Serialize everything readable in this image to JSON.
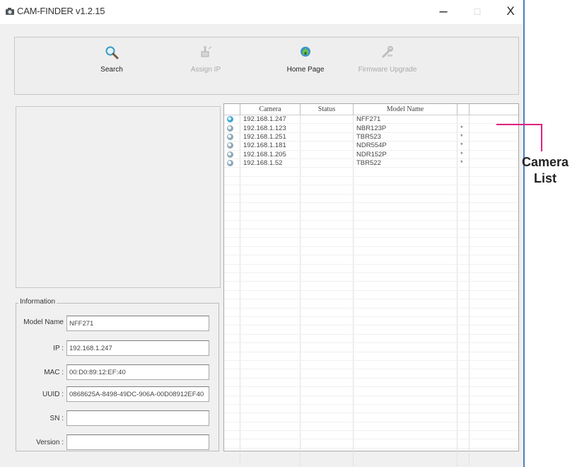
{
  "window": {
    "title": "CAM-FINDER v1.2.15",
    "minimize_glyph": "–",
    "maximize_glyph": "□",
    "close_glyph": "X"
  },
  "toolbar": {
    "search_label": "Search",
    "assign_ip_label": "Assign IP",
    "home_page_label": "Home Page",
    "firmware_upgrade_label": "Firmware Upgrade"
  },
  "camera_list": {
    "columns": [
      "Camera",
      "Status",
      "Model Name"
    ],
    "rows": [
      {
        "camera": "192.168.1.247",
        "status": "",
        "model": "NFF271",
        "mark": ""
      },
      {
        "camera": "192.168.1.123",
        "status": "",
        "model": "NBR123P",
        "mark": "*"
      },
      {
        "camera": "192.168.1.251",
        "status": "",
        "model": "TBR523",
        "mark": "*"
      },
      {
        "camera": "192.168.1.181",
        "status": "",
        "model": "NDR554P",
        "mark": "*"
      },
      {
        "camera": "192.168.1.205",
        "status": "",
        "model": "NDR152P",
        "mark": "*"
      },
      {
        "camera": "192.168.1.52",
        "status": "",
        "model": "TBR522",
        "mark": "*"
      }
    ]
  },
  "information": {
    "legend": "Information",
    "model_name_label": "Model Name",
    "model_name_value": "NFF271",
    "ip_label": "IP :",
    "ip_value": "192.168.1.247",
    "mac_label": "MAC :",
    "mac_value": "00:D0:89:12:EF:40",
    "uuid_label": "UUID :",
    "uuid_value": "0868625A-8498-49DC-906A-00D08912EF40",
    "sn_label": "SN :",
    "sn_value": "",
    "version_label": "Version :",
    "version_value": ""
  },
  "annotation": {
    "line1": "Camera",
    "line2": "List",
    "color": "#e0217f"
  },
  "icons": {
    "app": "camera-app-icon",
    "search": "magnifier-icon",
    "assign_ip": "network-icon",
    "home_page": "globe-house-icon",
    "firmware": "tools-icon"
  }
}
